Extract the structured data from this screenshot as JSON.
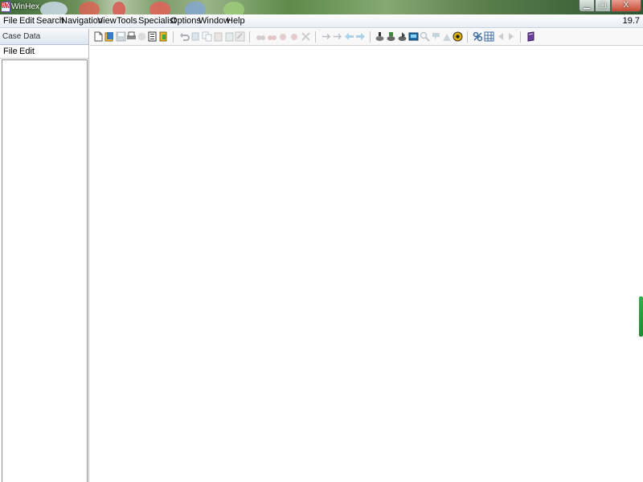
{
  "window": {
    "title": "WinHex",
    "icon_text": [
      "HEX",
      "WIN"
    ]
  },
  "window_controls": [
    {
      "name": "minimize-button",
      "glyph": "▁"
    },
    {
      "name": "maximize-button",
      "glyph": "▢"
    },
    {
      "name": "close-button",
      "glyph": "X"
    }
  ],
  "menu": {
    "items": [
      "File",
      "Edit",
      "Search",
      "Navigation",
      "View",
      "Tools",
      "Specialist",
      "Options",
      "Window",
      "Help"
    ],
    "version": "19.7"
  },
  "case_panel": {
    "title": "Case Data",
    "menu": [
      "File",
      "Edit"
    ]
  },
  "toolbar": {
    "groups": [
      [
        "new-file-icon",
        "open-file-icon",
        "save-icon",
        "print-icon",
        "properties-icon",
        "export-icon",
        "exit-icon"
      ],
      [
        "undo-icon",
        "cut-icon",
        "copy-icon",
        "paste-icon",
        "paste-into-icon",
        "write-icon"
      ],
      [
        "find-text-icon",
        "find-hex-icon",
        "replace-text-icon",
        "replace-hex-icon",
        "combined-search-icon"
      ],
      [
        "goto-offset-icon",
        "goto-sector-icon",
        "back-icon",
        "forward-icon"
      ],
      [
        "open-disk-icon",
        "clone-disk-icon",
        "image-disk-icon",
        "ram-editor-icon",
        "explore-icon",
        "hash-icon",
        "analyze-icon",
        "gear-icon"
      ],
      [
        "calculator-icon",
        "table-icon",
        "prev-icon",
        "next-icon"
      ],
      [
        "help-book-icon"
      ]
    ]
  },
  "colors": {
    "accent": "#3a6ea5",
    "scroll_indicator": "#2fb04a"
  }
}
